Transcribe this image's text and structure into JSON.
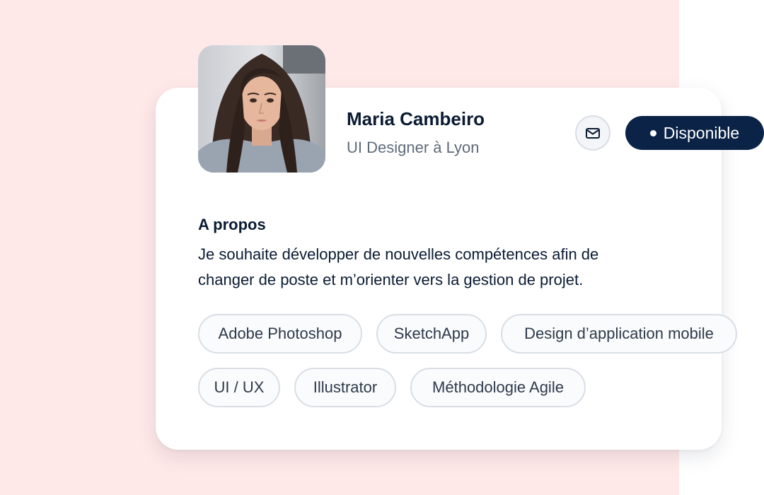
{
  "colors": {
    "page_background": "#ffe8e8",
    "card_background": "#ffffff",
    "badge_background": "#0b2347",
    "text_primary": "#0b1b33",
    "text_secondary": "#5f6b7a",
    "tag_border": "#d9dee5"
  },
  "profile": {
    "avatar_icon": "profile-photo",
    "name": "Maria Cambeiro",
    "role": "UI Designer à Lyon",
    "mail_icon": "mail-icon",
    "status": "Disponible"
  },
  "about": {
    "title": "A propos",
    "line1": "Je souhaite développer de nouvelles compétences afin de",
    "line2": "changer de poste et m’orienter vers la gestion de projet."
  },
  "skills": [
    "Adobe Photoshop",
    "SketchApp",
    "Design d’application mobile",
    "UI / UX",
    "Illustrator",
    "Méthodologie Agile"
  ]
}
